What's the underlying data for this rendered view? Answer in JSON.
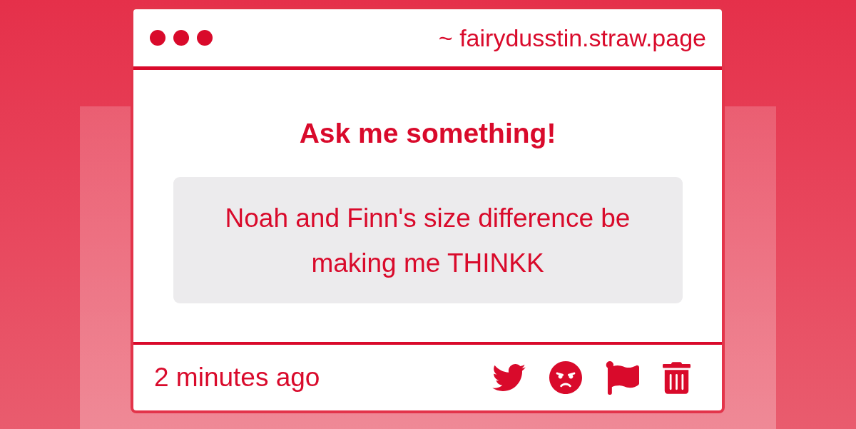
{
  "header": {
    "url": "~ fairydusstin.straw.page"
  },
  "prompt": {
    "title": "Ask me something!"
  },
  "question": {
    "text": "Noah and Finn's size difference be making me THINKK"
  },
  "footer": {
    "time": "2 minutes ago"
  }
}
